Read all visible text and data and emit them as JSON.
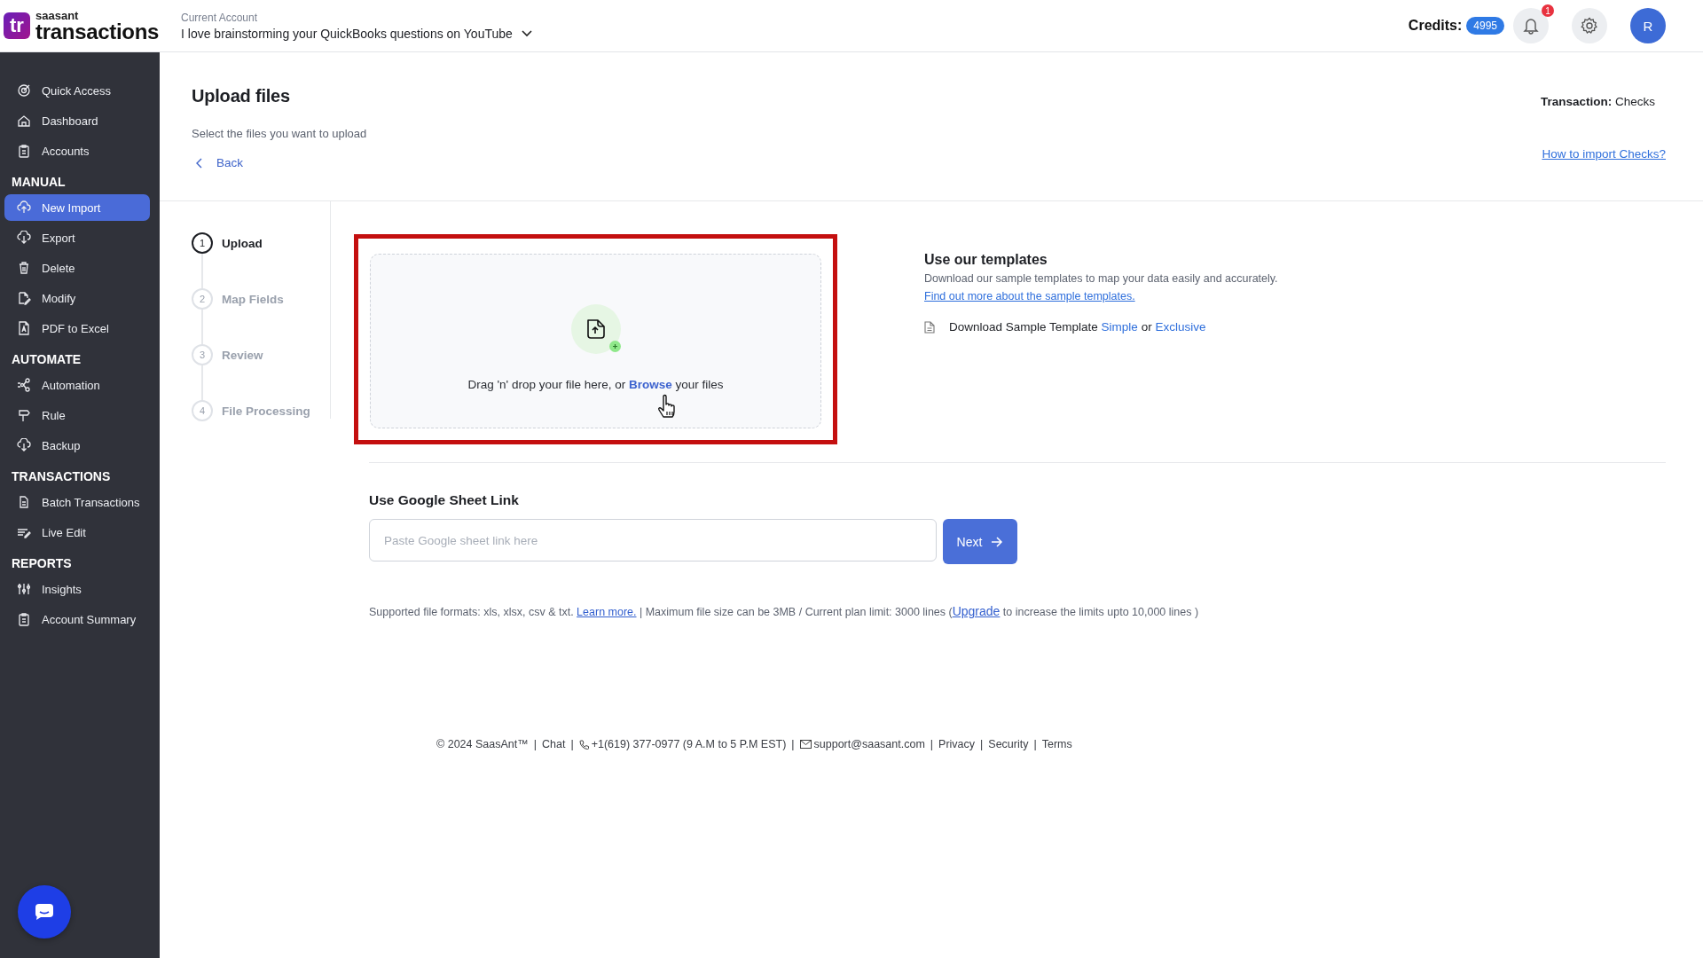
{
  "header": {
    "logo_mark": "tr",
    "logo_small": "saasant",
    "logo_text": "transactions",
    "account_label": "Current Account",
    "account_name": "I love brainstorming your QuickBooks questions on YouTube",
    "credits_label": "Credits:",
    "credits": "4995",
    "notification_count": "1",
    "avatar": "R"
  },
  "sidebar": {
    "sections": [
      {
        "items": [
          {
            "label": "Quick Access",
            "selected": false
          },
          {
            "label": "Dashboard",
            "selected": false
          },
          {
            "label": "Accounts",
            "selected": false
          }
        ]
      },
      {
        "title": "MANUAL",
        "items": [
          {
            "label": "New Import",
            "selected": true
          },
          {
            "label": "Export",
            "selected": false
          },
          {
            "label": "Delete",
            "selected": false
          },
          {
            "label": "Modify",
            "selected": false
          },
          {
            "label": "PDF to Excel",
            "selected": false
          }
        ]
      },
      {
        "title": "AUTOMATE",
        "items": [
          {
            "label": "Automation",
            "selected": false
          },
          {
            "label": "Rule",
            "selected": false
          },
          {
            "label": "Backup",
            "selected": false
          }
        ]
      },
      {
        "title": "TRANSACTIONS",
        "items": [
          {
            "label": "Batch Transactions",
            "selected": false
          },
          {
            "label": "Live Edit",
            "selected": false
          }
        ]
      },
      {
        "title": "REPORTS",
        "items": [
          {
            "label": "Insights",
            "selected": false
          },
          {
            "label": "Account Summary",
            "selected": false
          }
        ]
      }
    ]
  },
  "page": {
    "title": "Upload files",
    "subtitle": "Select the files you want to upload",
    "back": "Back",
    "transaction_label": "Transaction:",
    "transaction_value": "Checks",
    "help_link": "How to import Checks?"
  },
  "steps": [
    {
      "number": "1",
      "label": "Upload",
      "selected": true
    },
    {
      "number": "2",
      "label": "Map Fields",
      "selected": false
    },
    {
      "number": "3",
      "label": "Review",
      "selected": false
    },
    {
      "number": "4",
      "label": "File Processing",
      "selected": false
    }
  ],
  "dropzone": {
    "text_before": "Drag 'n' drop your file here, or",
    "link": "Browse",
    "text_after": "your files"
  },
  "templates": {
    "title": "Use our templates",
    "description": "Download our sample templates to map your data easily and accurately.",
    "link": "Find out more about the sample templates.",
    "download_label": "Download Sample Template",
    "simple": "Simple",
    "or": "or",
    "exclusive": "Exclusive"
  },
  "google_sheet": {
    "title": "Use Google Sheet Link",
    "placeholder": "Paste Google sheet link here",
    "button": "Next"
  },
  "info": {
    "formats": "Supported file formats: xls, xlsx, csv & txt.",
    "learn_more": "Learn more.",
    "separator": "|",
    "limit": "Maximum file size can be 3MB / Current plan limit: 3000 lines (",
    "upgrade": "Upgrade",
    "tail": "to increase the limits upto 10,000 lines )"
  },
  "footer": {
    "separator": "|",
    "items": [
      {
        "kind": "text",
        "text": "© 2024 SaasAnt™"
      },
      {
        "kind": "link",
        "text": "Chat"
      },
      {
        "kind": "phone",
        "text": "+1(619) 377-0977 (9 A.M to 5 P.M EST)"
      },
      {
        "kind": "email",
        "text": "support@saasant.com"
      },
      {
        "kind": "link",
        "text": "Privacy"
      },
      {
        "kind": "link",
        "text": "Security"
      },
      {
        "kind": "link",
        "text": "Terms"
      }
    ]
  }
}
